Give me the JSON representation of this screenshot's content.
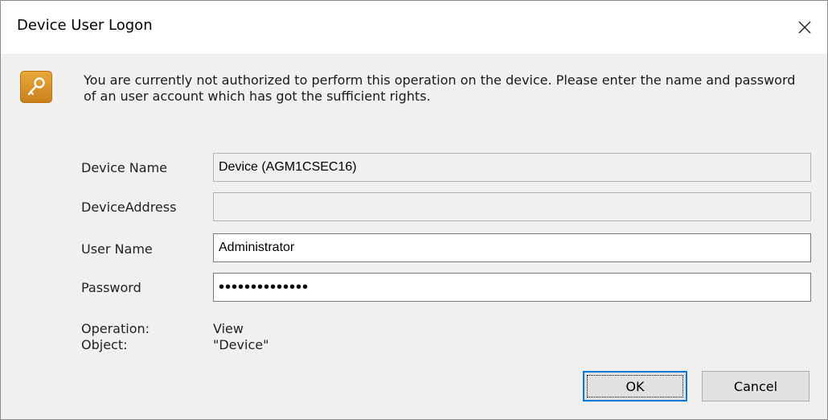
{
  "window": {
    "title": "Device User Logon",
    "close_icon": "close-icon"
  },
  "message": {
    "icon": "key-icon",
    "text": "You are currently not authorized to perform this operation on the device. Please enter the name and password of an user account which has got the sufficient rights."
  },
  "form": {
    "device_name": {
      "label": "Device Name",
      "value": "Device (AGM1CSEC16)"
    },
    "device_address": {
      "label": "DeviceAddress",
      "value": ""
    },
    "user_name": {
      "label": "User Name",
      "value": "Administrator"
    },
    "password": {
      "label": "Password",
      "value": "••••••••••••••"
    }
  },
  "info": {
    "operation_label": "Operation:",
    "operation_value": "View",
    "object_label": "Object:",
    "object_value": "\"Device\""
  },
  "buttons": {
    "ok": "OK",
    "cancel": "Cancel"
  },
  "colors": {
    "accent": "#0078d7",
    "icon_orange": "#e09a2e",
    "dialog_bg": "#f0f0f0"
  }
}
